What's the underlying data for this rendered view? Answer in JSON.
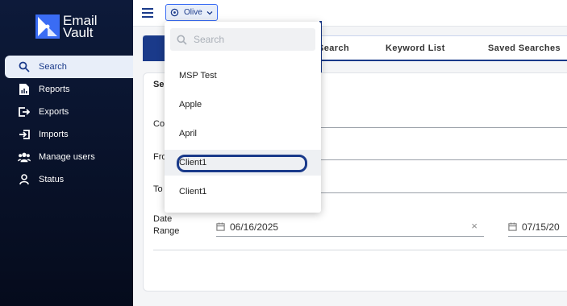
{
  "brand": {
    "line1": "Email",
    "line2": "Vault"
  },
  "sidebar": {
    "items": [
      {
        "label": "Search",
        "icon": "search-icon"
      },
      {
        "label": "Reports",
        "icon": "report-icon"
      },
      {
        "label": "Exports",
        "icon": "export-icon"
      },
      {
        "label": "Imports",
        "icon": "import-icon"
      },
      {
        "label": "Manage users",
        "icon": "users-icon"
      },
      {
        "label": "Status",
        "icon": "user-icon"
      }
    ]
  },
  "topbar": {
    "tenant": "Olive"
  },
  "tabs": [
    "Search",
    "Keyword List",
    "Saved Searches"
  ],
  "form": {
    "section_title": "Se",
    "labels": {
      "c": "Co",
      "from": "Fro",
      "to": "To"
    },
    "date_range_label_1": "Date",
    "date_range_label_2": "Range",
    "date_from": "06/16/2025",
    "date_to": "07/15/20",
    "clear_symbol": "×"
  },
  "dropdown": {
    "search_placeholder": "Search",
    "items": [
      "MSP Test",
      "Apple",
      "April",
      "Client1",
      "Client1"
    ],
    "highlighted_index": 3
  },
  "colors": {
    "accent": "#1a3a8a",
    "sidebar": "#0d1a3a",
    "brand_blue": "#3a6cf4"
  }
}
